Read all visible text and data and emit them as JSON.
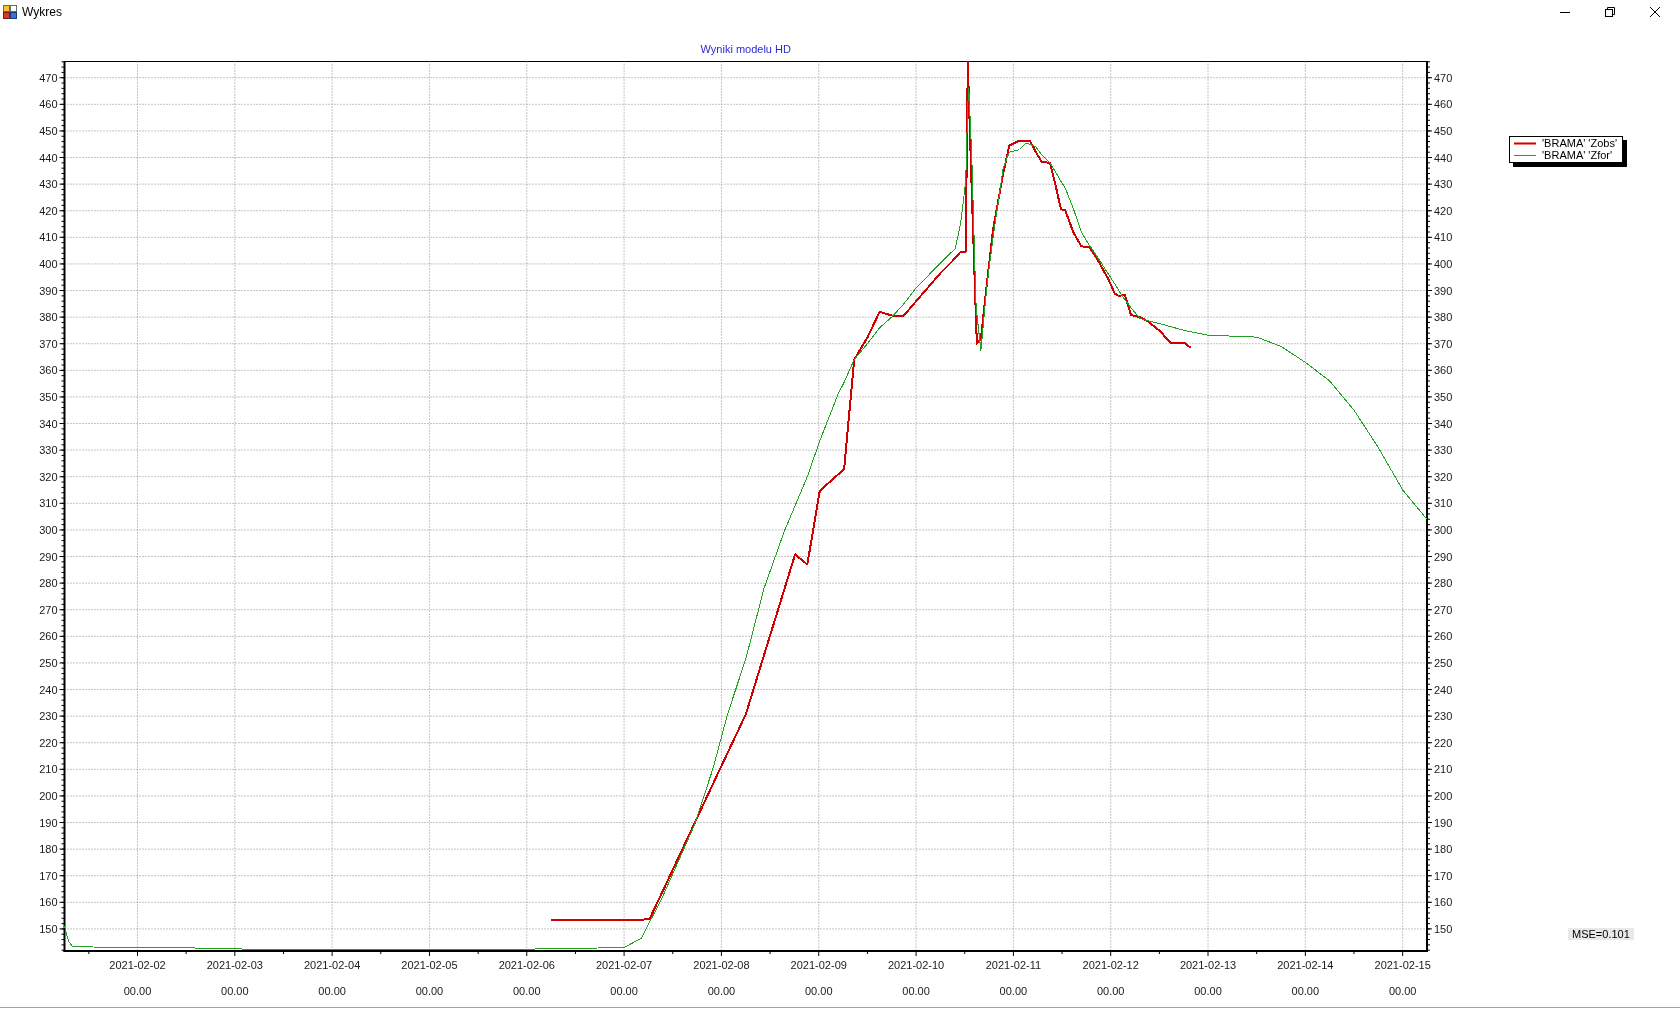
{
  "window": {
    "title": "Wykres"
  },
  "chart": {
    "chart_data": {
      "type": "line",
      "title": "Wyniki modelu HD",
      "grid": true,
      "x": [
        "2021-02-01 06:00",
        "2021-02-01 07:00",
        "2021-02-01 08:00",
        "2021-02-01 18:00",
        "2021-02-02 12:00",
        "2021-02-03 00:00",
        "2021-02-03 12:00",
        "2021-02-04 12:00",
        "2021-02-05 12:00",
        "2021-02-06 06:00",
        "2021-02-07 00:00",
        "2021-02-07 04:15",
        "2021-02-07 06:15",
        "2021-02-07 09:15",
        "2021-02-07 17:20",
        "2021-02-07 22:00",
        "2021-02-08 01:30",
        "2021-02-08 06:00",
        "2021-02-08 10:30",
        "2021-02-08 15:30",
        "2021-02-08 18:10",
        "2021-02-08 21:10",
        "2021-02-09 00:15",
        "2021-02-09 04:45",
        "2021-02-09 06:15",
        "2021-02-09 08:45",
        "2021-02-09 12:00",
        "2021-02-09 15:00",
        "2021-02-09 18:00",
        "2021-02-09 21:00",
        "2021-02-10 00:00",
        "2021-02-10 06:00",
        "2021-02-10 09:40",
        "2021-02-10 11:00",
        "2021-02-10 12:15",
        "2021-02-10 12:45",
        "2021-02-10 13:00",
        "2021-02-10 13:45",
        "2021-02-10 14:45",
        "2021-02-10 15:00",
        "2021-02-10 16:00",
        "2021-02-10 17:30",
        "2021-02-10 19:00",
        "2021-02-10 21:30",
        "2021-02-10 23:00",
        "2021-02-11 01:30",
        "2021-02-11 03:00",
        "2021-02-11 04:00",
        "2021-02-11 05:30",
        "2021-02-11 07:00",
        "2021-02-11 09:00",
        "2021-02-11 10:15",
        "2021-02-11 11:45",
        "2021-02-11 12:45",
        "2021-02-11 14:45",
        "2021-02-11 16:45",
        "2021-02-11 18:45",
        "2021-02-11 21:00",
        "2021-02-11 23:30",
        "2021-02-12 01:00",
        "2021-02-12 02:00",
        "2021-02-12 03:30",
        "2021-02-12 05:00",
        "2021-02-12 07:15",
        "2021-02-12 09:15",
        "2021-02-12 12:15",
        "2021-02-12 14:45",
        "2021-02-12 18:15",
        "2021-02-12 19:45",
        "2021-02-13 00:00",
        "2021-02-13 12:00",
        "2021-02-13 18:00",
        "2021-02-14 00:00",
        "2021-02-14 06:00",
        "2021-02-14 12:00",
        "2021-02-14 18:00",
        "2021-02-15 00:00",
        "2021-02-15 06:00"
      ],
      "series": [
        {
          "name": "'BRAMA' 'Zobs'",
          "color": "#d00000",
          "values": [
            null,
            null,
            null,
            null,
            null,
            null,
            null,
            null,
            null,
            153.5,
            153.5,
            153.5,
            153.6,
            163.3,
            189.6,
            204.8,
            216.1,
            230.7,
            252.9,
            277.6,
            290.8,
            287,
            314.7,
            320.8,
            322.8,
            364,
            372.3,
            382,
            380.6,
            380.6,
            386,
            396.5,
            402.2,
            404.6,
            404.6,
            476,
            463,
            427,
            380,
            370,
            372,
            393,
            413,
            434,
            444.5,
            446.4,
            446.4,
            446.4,
            442.2,
            438.3,
            438,
            430.6,
            420.5,
            420.3,
            412,
            406.6,
            406.4,
            401,
            394,
            388.8,
            388,
            388.4,
            380.8,
            380,
            378.3,
            374.6,
            370.3,
            370.3,
            368.4,
            null,
            null,
            null,
            null,
            null,
            null,
            null,
            null,
            null
          ]
        },
        {
          "name": "'BRAMA' 'Zfor'",
          "color": "#22a022",
          "values": [
            151,
            145.3,
            143.4,
            143,
            142.9,
            142.5,
            142.2,
            142.1,
            142.3,
            142.5,
            143,
            146.5,
            152.4,
            161.3,
            189,
            210.7,
            230.7,
            251.5,
            278,
            299.5,
            309.1,
            320,
            333.5,
            351,
            355.5,
            364,
            370,
            376,
            380,
            385,
            391,
            400.3,
            405.8,
            415.4,
            431,
            460,
            466,
            440,
            385.7,
            381,
            367.5,
            392,
            410,
            436,
            442,
            443,
            445.3,
            445,
            444,
            441,
            438,
            435,
            431,
            428.6,
            421,
            412,
            407,
            402,
            396,
            392.5,
            390,
            386.5,
            383.5,
            379.5,
            378.6,
            377.5,
            376.4,
            375,
            374.5,
            373.2,
            372.5,
            369,
            363,
            356,
            345,
            331,
            315,
            304
          ]
        }
      ],
      "xlim": [
        "2021-02-01 06:00",
        "2021-02-15 06:00"
      ],
      "ylim": [
        141.7,
        476.1
      ],
      "xticks": [
        {
          "value": "2021-02-02 00:00",
          "label": "2021-02-02"
        },
        {
          "value": "2021-02-03 00:00",
          "label": "2021-02-03"
        },
        {
          "value": "2021-02-04 00:00",
          "label": "2021-02-04"
        },
        {
          "value": "2021-02-05 00:00",
          "label": "2021-02-05"
        },
        {
          "value": "2021-02-06 00:00",
          "label": "2021-02-06"
        },
        {
          "value": "2021-02-07 00:00",
          "label": "2021-02-07"
        },
        {
          "value": "2021-02-08 00:00",
          "label": "2021-02-08"
        },
        {
          "value": "2021-02-09 00:00",
          "label": "2021-02-09"
        },
        {
          "value": "2021-02-10 00:00",
          "label": "2021-02-10"
        },
        {
          "value": "2021-02-11 00:00",
          "label": "2021-02-11"
        },
        {
          "value": "2021-02-12 00:00",
          "label": "2021-02-12"
        },
        {
          "value": "2021-02-13 00:00",
          "label": "2021-02-13"
        },
        {
          "value": "2021-02-14 00:00",
          "label": "2021-02-14"
        },
        {
          "value": "2021-02-15 00:00",
          "label": "2021-02-15"
        }
      ],
      "yticks": [
        {
          "value": 470,
          "label": "470"
        },
        {
          "value": 460,
          "label": "460"
        },
        {
          "value": 450,
          "label": "450"
        },
        {
          "value": 440,
          "label": "440"
        },
        {
          "value": 430,
          "label": "430"
        },
        {
          "value": 420,
          "label": "420"
        },
        {
          "value": 410,
          "label": "410"
        },
        {
          "value": 400,
          "label": "400"
        },
        {
          "value": 390,
          "label": "390"
        },
        {
          "value": 380,
          "label": "380"
        },
        {
          "value": 370,
          "label": "370"
        },
        {
          "value": 360,
          "label": "360"
        },
        {
          "value": 350,
          "label": "350"
        },
        {
          "value": 340,
          "label": "340"
        },
        {
          "value": 330,
          "label": "330"
        },
        {
          "value": 320,
          "label": "320"
        },
        {
          "value": 310,
          "label": "310"
        },
        {
          "value": 300,
          "label": "300"
        },
        {
          "value": 290,
          "label": "290"
        },
        {
          "value": 280,
          "label": "280"
        },
        {
          "value": 270,
          "label": "270"
        },
        {
          "value": 260,
          "label": "260"
        },
        {
          "value": 250,
          "label": "250"
        },
        {
          "value": 240,
          "label": "240"
        },
        {
          "value": 230,
          "label": "230"
        },
        {
          "value": 220,
          "label": "220"
        },
        {
          "value": 210,
          "label": "210"
        },
        {
          "value": 200,
          "label": "200"
        },
        {
          "value": 190,
          "label": "190"
        },
        {
          "value": 180,
          "label": "180"
        },
        {
          "value": 170,
          "label": "170"
        },
        {
          "value": 160,
          "label": "160"
        },
        {
          "value": 150,
          "label": "150"
        }
      ]
    },
    "right_axis_labels": [
      "470",
      "460",
      "450",
      "440",
      "430",
      "420",
      "410",
      "400",
      "390",
      "380",
      "370",
      "360",
      "350",
      "340",
      "330",
      "320",
      "310",
      "300",
      "290",
      "280",
      "270",
      "260",
      "250",
      "240",
      "230",
      "220",
      "210",
      "200",
      "190",
      "180",
      "170",
      "160",
      "150"
    ],
    "x_axis_time_labels": [
      "00.00",
      "00.00",
      "00.00",
      "00.00",
      "00.00",
      "00.00",
      "00.00",
      "00.00",
      "00.00",
      "00.00",
      "00.00",
      "00.00",
      "00.00",
      "00.00"
    ]
  },
  "mse_label": "MSE=0.101"
}
